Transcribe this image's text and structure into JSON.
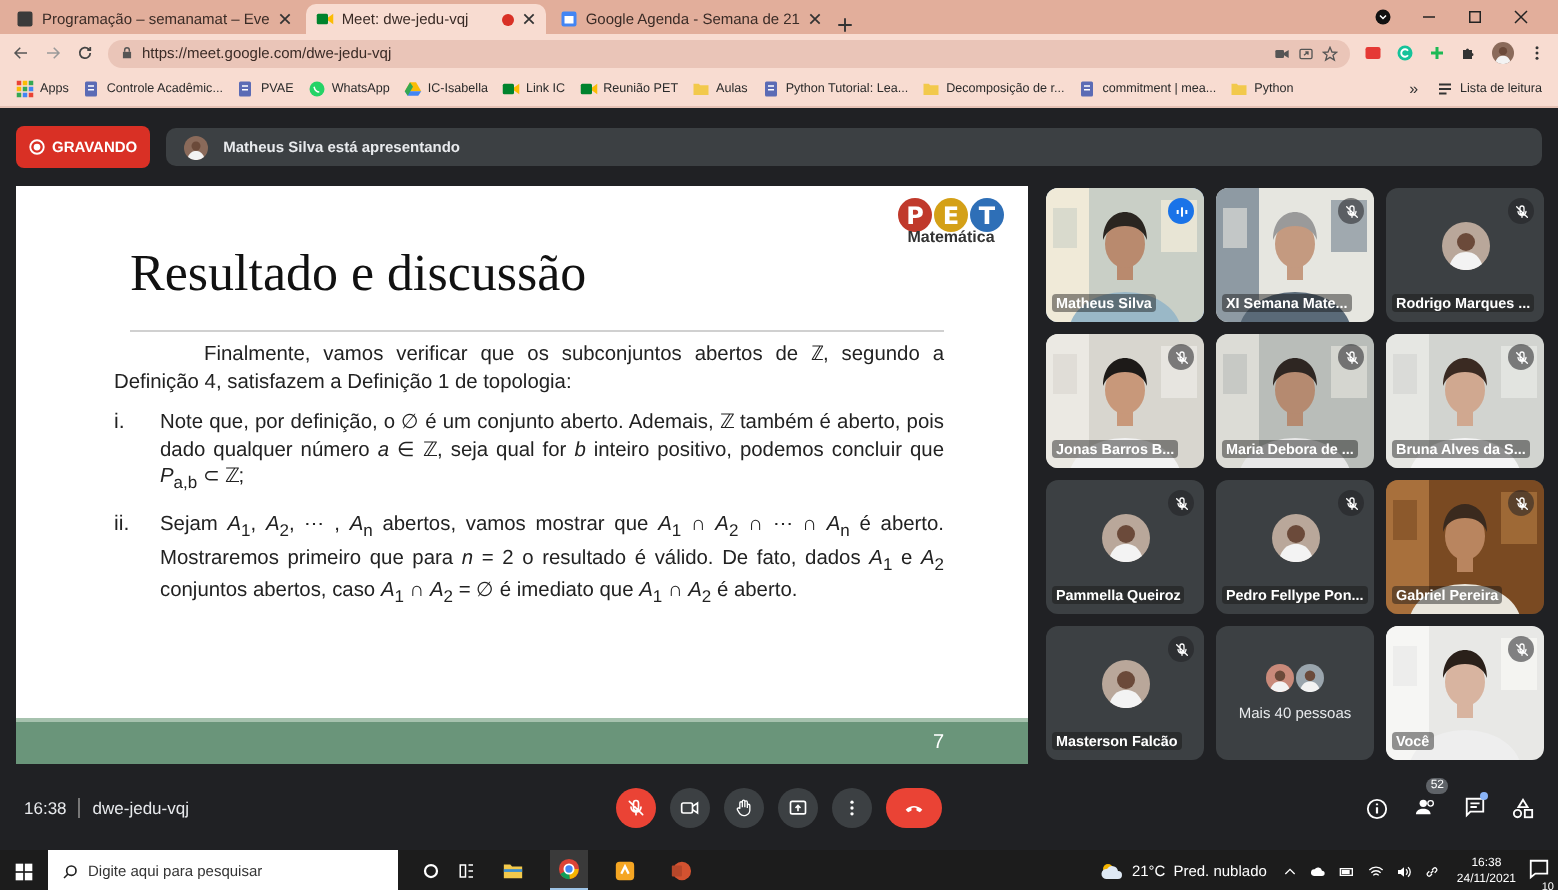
{
  "browser": {
    "tabs": [
      {
        "title": "Programação – semanamat – Eve",
        "selected": false,
        "recording": false
      },
      {
        "title": "Meet: dwe-jedu-vqj",
        "selected": true,
        "recording": true
      },
      {
        "title": "Google Agenda - Semana de 21",
        "selected": false,
        "recording": false
      }
    ],
    "url": "https://meet.google.com/dwe-jedu-vqj",
    "bookmarks": [
      {
        "label": "Apps",
        "kind": "apps"
      },
      {
        "label": "Controle Acadêmic...",
        "kind": "site"
      },
      {
        "label": "PVAE",
        "kind": "site"
      },
      {
        "label": "WhatsApp",
        "kind": "chat"
      },
      {
        "label": "IC-Isabella",
        "kind": "drive"
      },
      {
        "label": "Link IC",
        "kind": "meet"
      },
      {
        "label": "Reunião PET",
        "kind": "meet"
      },
      {
        "label": "Aulas",
        "kind": "folder"
      },
      {
        "label": "Python Tutorial: Lea...",
        "kind": "site"
      },
      {
        "label": "Decomposição de r...",
        "kind": "folder"
      },
      {
        "label": "commitment | mea...",
        "kind": "site"
      },
      {
        "label": "Python",
        "kind": "folder"
      }
    ],
    "bookmarks_overflow": "»",
    "reading_list": "Lista de leitura"
  },
  "meet": {
    "recording_label": "GRAVANDO",
    "presenting": "Matheus Silva está apresentando",
    "slide": {
      "title": "Resultado e discussão",
      "logo_letters": [
        "P",
        "E",
        "T"
      ],
      "logo_caption": "Matemática",
      "intro": "Finalmente, vamos verificar que os subconjuntos abertos de ℤ, segundo a Definição 4, satisfazem a Definição 1 de topologia:",
      "items": [
        {
          "marker": "i.",
          "text": "Note que, por definição, o ∅ é um conjunto aberto. Ademais, ℤ também é aberto, pois dado qualquer número *a* ∈ ℤ, seja qual for *b* inteiro positivo, podemos concluir que *P*$_{a,b}$ ⊂ ℤ;"
        },
        {
          "marker": "ii.",
          "text": "Sejam *A*$_{1}$, *A*$_{2}$, ⋯ , *A*$_{n}$ abertos, vamos mostrar que *A*$_{1}$ ∩ *A*$_{2}$ ∩ ⋯ ∩ *A*$_{n}$ é aberto. Mostraremos primeiro que para *n* = 2 o resultado é válido. De fato, dados *A*$_{1}$ e *A*$_{2}$ conjuntos abertos, caso *A*$_{1}$ ∩ *A*$_{2}$ = ∅ é imediato que *A*$_{1}$ ∩ *A*$_{2}$ é aberto."
        }
      ],
      "page": "7"
    },
    "tiles": [
      {
        "name": "Matheus Silva",
        "kind": "video",
        "muted": false,
        "speaking": true
      },
      {
        "name": "XI Semana Mate...",
        "kind": "video",
        "muted": true,
        "speaking": false
      },
      {
        "name": "Rodrigo Marques ...",
        "kind": "avatar",
        "muted": true,
        "speaking": false
      },
      {
        "name": "Jonas Barros B...",
        "kind": "video",
        "muted": true,
        "speaking": false
      },
      {
        "name": "Maria Debora de ...",
        "kind": "video",
        "muted": true,
        "speaking": false
      },
      {
        "name": "Bruna Alves da S...",
        "kind": "video",
        "muted": true,
        "speaking": false
      },
      {
        "name": "Pammella Queiroz",
        "kind": "avatar",
        "muted": true,
        "speaking": false
      },
      {
        "name": "Pedro Fellype Pon...",
        "kind": "avatar",
        "muted": true,
        "speaking": false
      },
      {
        "name": "Gabriel Pereira",
        "kind": "video",
        "muted": true,
        "speaking": false
      },
      {
        "name": "Masterson Falcão",
        "kind": "avatar",
        "muted": true,
        "speaking": false
      },
      {
        "name": "Mais 40 pessoas",
        "kind": "more",
        "muted": false,
        "speaking": false
      },
      {
        "name": "Você",
        "kind": "video",
        "muted": true,
        "speaking": false
      }
    ],
    "time": "16:38",
    "meeting_code": "dwe-jedu-vqj",
    "mic_muted": true,
    "people_count": "52",
    "chat_unread": true
  },
  "taskbar": {
    "search_placeholder": "Digite aqui para pesquisar",
    "temperature": "21°C",
    "forecast": "Pred. nublado",
    "time": "16:38",
    "date": "24/11/2021",
    "notifications": "10"
  }
}
